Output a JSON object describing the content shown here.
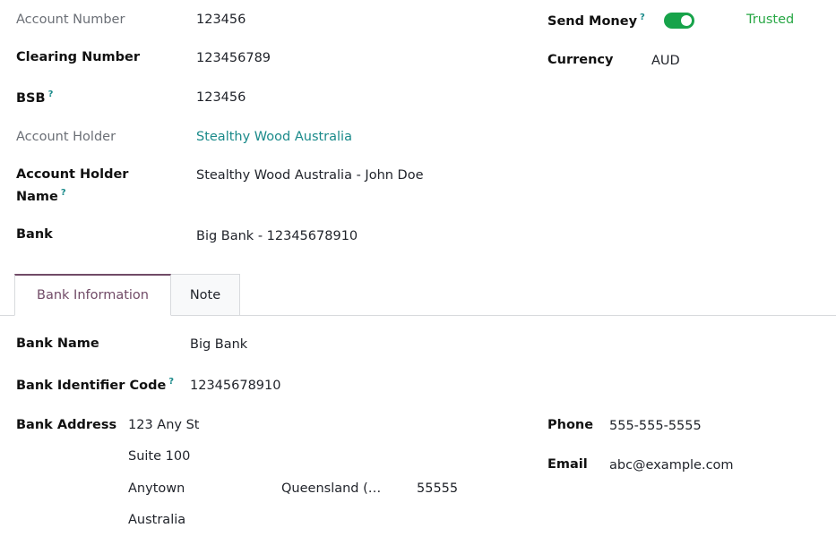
{
  "fields": {
    "account_number": {
      "label": "Account Number",
      "value": "123456"
    },
    "clearing_number": {
      "label": "Clearing Number",
      "value": "123456789"
    },
    "bsb": {
      "label": "BSB",
      "help": "?",
      "value": "123456"
    },
    "account_holder": {
      "label": "Account Holder",
      "value": "Stealthy Wood Australia"
    },
    "account_holder_name": {
      "label_line1": "Account Holder",
      "label_line2": "Name",
      "help": "?",
      "value": "Stealthy Wood Australia - John Doe"
    },
    "bank": {
      "label": "Bank",
      "value": "Big Bank - 12345678910"
    },
    "send_money": {
      "label": "Send Money",
      "help": "?",
      "enabled": true,
      "status": "Trusted"
    },
    "currency": {
      "label": "Currency",
      "value": "AUD"
    }
  },
  "tabs": [
    {
      "label": "Bank Information",
      "active": true
    },
    {
      "label": "Note",
      "active": false
    }
  ],
  "bank_info": {
    "bank_name": {
      "label": "Bank Name",
      "value": "Big Bank"
    },
    "bic": {
      "label": "Bank Identifier Code",
      "help": "?",
      "value": "12345678910"
    },
    "address": {
      "label": "Bank Address",
      "street": "123 Any St",
      "street2": "Suite 100",
      "city": "Anytown",
      "state": "Queensland (…",
      "zip": "55555",
      "country": "Australia"
    },
    "phone": {
      "label": "Phone",
      "value": "555-555-5555"
    },
    "email": {
      "label": "Email",
      "value": "abc@example.com"
    }
  },
  "colors": {
    "accent": "#714b67",
    "link": "#1a8a8a",
    "toggle_on": "#17a34a",
    "trusted": "#28a745"
  }
}
